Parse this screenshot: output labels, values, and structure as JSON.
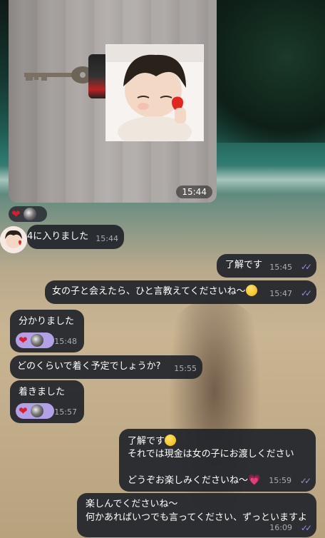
{
  "colors": {
    "bubble_bg": "#21252B",
    "text": "#FFFFFF",
    "time": "#A9ADB4",
    "read_checks": "#8C8FE0",
    "reaction_bg": "#B2A1E6",
    "heart": "#E0192C"
  },
  "photo_message": {
    "time": "15:44"
  },
  "reactions": {
    "icon": "red-heart",
    "count_avatar": "avatar"
  },
  "messages": [
    {
      "id": "m1",
      "from": "them",
      "text": "4に入りました",
      "time": "15:44"
    },
    {
      "id": "m2",
      "from": "me",
      "text": "了解です",
      "time": "15:45",
      "status": "read"
    },
    {
      "id": "m3",
      "from": "me",
      "text": "女の子と会えたら、ひと言教えてくださいね〜",
      "time": "15:47",
      "status": "read",
      "emoji": "smiling-face"
    },
    {
      "id": "m4",
      "from": "them",
      "text": "分かりました",
      "time": "15:48",
      "reaction": "red-heart"
    },
    {
      "id": "m5",
      "from": "them",
      "text": "どのくらいで着く予定でしょうか?",
      "time": "15:55"
    },
    {
      "id": "m6",
      "from": "them",
      "text": "着きました",
      "time": "15:57",
      "reaction": "red-heart"
    },
    {
      "id": "m7",
      "from": "me",
      "lines": [
        "了解です",
        "それでは現金は女の子にお渡しください",
        "どうぞお楽しみくださいね〜"
      ],
      "time": "15:59",
      "status": "read"
    },
    {
      "id": "m8",
      "from": "me",
      "lines": [
        "楽しんでくださいね〜",
        "何かあればいつでも言ってください、ずっといますよ"
      ],
      "time": "16:09",
      "status": "read"
    }
  ]
}
